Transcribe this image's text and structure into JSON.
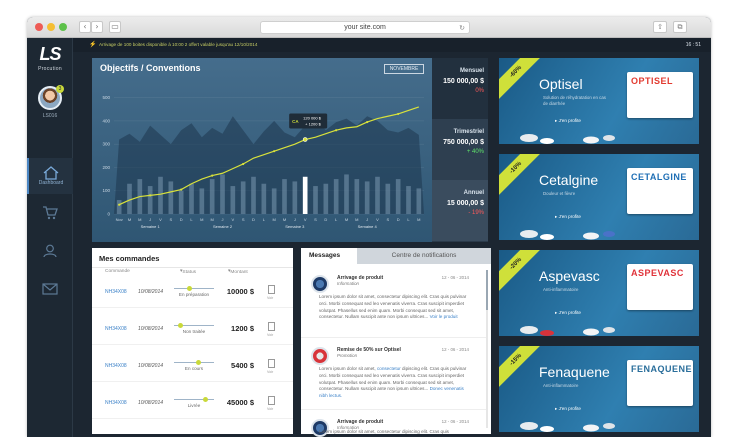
{
  "browser": {
    "url": "your site.com",
    "colors": {
      "red": "#ee5b55",
      "yellow": "#f5be33",
      "green": "#5dc14a"
    }
  },
  "app": {
    "logo_mark": "LS",
    "logo_name": "Procution",
    "user_name": "LS016",
    "user_badge": "3",
    "nav": [
      {
        "label": "Dashboard",
        "icon": "home-icon",
        "active": true
      },
      {
        "label": "",
        "icon": "cart-icon",
        "active": false
      },
      {
        "label": "",
        "icon": "user-icon",
        "active": false
      },
      {
        "label": "",
        "icon": "mail-icon",
        "active": false
      }
    ],
    "ticker": "Arrivage de 100 boites disponible à 10:00 2 offert valable jusqu'au 12/10/2014",
    "clock": "16 : 51"
  },
  "chart_data": {
    "type": "line",
    "title": "Objectifs / Conventions",
    "period": "NOVEMBRE",
    "y_ticks": [
      0,
      100,
      200,
      300,
      400,
      500
    ],
    "ylim": [
      0,
      550
    ],
    "x_labels": [
      "Nov",
      "M",
      "M",
      "J",
      "V",
      "S",
      "D",
      "L",
      "M",
      "M",
      "J",
      "V",
      "S",
      "D",
      "L",
      "M",
      "M",
      "J",
      "V",
      "S",
      "D",
      "L",
      "M",
      "M",
      "J",
      "V",
      "S",
      "D",
      "L",
      "M"
    ],
    "week_labels": [
      "Semaine 1",
      "Semaine 2",
      "Semaine 3",
      "Semaine 4"
    ],
    "series": [
      {
        "values": [
          40,
          60,
          75,
          80,
          85,
          95,
          105,
          130,
          150,
          165,
          175,
          195,
          215,
          240,
          255,
          270,
          285,
          300,
          320,
          330,
          345,
          360,
          370,
          375,
          395,
          410,
          420,
          430,
          445,
          460
        ]
      }
    ],
    "area_values": [
      320,
      345,
      310,
      380,
      340,
      300,
      360,
      390,
      330,
      370,
      345,
      420,
      360,
      300,
      355,
      400,
      350,
      330,
      380,
      410,
      360,
      395,
      410,
      380,
      420,
      400,
      360,
      350,
      370,
      340
    ],
    "bar_values": [
      60,
      130,
      150,
      120,
      160,
      140,
      100,
      130,
      110,
      150,
      170,
      120,
      140,
      160,
      130,
      110,
      150,
      140,
      160,
      120,
      130,
      150,
      170,
      150,
      140,
      160,
      130,
      150,
      120,
      110
    ],
    "highlight_index": 18,
    "tooltip": {
      "label": "CA",
      "line1": "120 000 $",
      "line2": "+ 1200 $"
    }
  },
  "summary": [
    {
      "title": "Mensuel",
      "value": "150 000,00 $",
      "pct": "0%",
      "pct_color": "#ff5a5a"
    },
    {
      "title": "Trimestriel",
      "value": "750 000,00 $",
      "pct": "+ 40%",
      "pct_color": "#5fe36a"
    },
    {
      "title": "Annuel",
      "value": "15 000,00 $",
      "pct": "- 19%",
      "pct_color": "#ff5a5a"
    }
  ],
  "commands": {
    "title": "Mes commandes",
    "headers": {
      "commande": "Commande",
      "status": "Status",
      "montant": "Montant"
    },
    "rows": [
      {
        "num": "NH34X08",
        "date": "10/08/2014",
        "status": "En préparation",
        "progress": 0.35,
        "amount": "10000 $",
        "voir": "Voir"
      },
      {
        "num": "NH34X08",
        "date": "10/08/2014",
        "status": "Non traitée",
        "progress": 0.1,
        "amount": "1200 $",
        "voir": "Voir"
      },
      {
        "num": "NH34X08",
        "date": "10/08/2014",
        "status": "En cours",
        "progress": 0.6,
        "amount": "5400 $",
        "voir": "Voir"
      },
      {
        "num": "NH34X08",
        "date": "10/08/2014",
        "status": "Livrée",
        "progress": 0.8,
        "amount": "45000 $",
        "voir": "Voir"
      }
    ]
  },
  "messages": {
    "tab_messages": "Messages",
    "tab_notifications": "Centre de notifications",
    "items": [
      {
        "title": "Arrivage de produit",
        "category": "Information",
        "date": "12 - 06 - 2014",
        "text_a": "Lorem ipsum dolor sit amet, consectetur dipiscing elit. Cras quis pulvinar orci. Morbi consequat sed leo venenatis viverra. Cras suscipit imperdiet volutpat. Phasellus sed enim quam. Morbi consequat sed sit amet, consectetur. Nullam suscipit ante non ipsum ultrices...",
        "link": "Voir le produit"
      },
      {
        "title": "Remise de 50% sur Optisel",
        "category": "Promotion",
        "date": "12 - 06 - 2014",
        "text_a": "Lorem ipsum dolor sit amet, ",
        "highlight": "consectetur",
        "text_b": " dipiscing elit. Cras quis pulvinar orci. Morbi consequat sed leo venenatis viverra. Cras suscipit imperdiet volutpat. Phasellus sed enim quam. Morbi consequat sed sit amet, consectetur. Nullam suscipit ante non ipsum ultrices...",
        "link": "Donec venenatis nibh lectus."
      },
      {
        "title": "Arrivage de produit",
        "category": "Information",
        "date": "12 - 06 - 2014",
        "text_a": "Lorem ipsum dolor sit amet, consectetur dipiscing elit. Cras quis",
        "link": ""
      }
    ]
  },
  "products": [
    {
      "discount": "-60%",
      "name": "Optisel",
      "desc": "Solution de réhydratation en cas de diarrhée",
      "cta": "J'en profite",
      "box_label": "OPTISEL",
      "box_color": "#e23a2f"
    },
    {
      "discount": "-10%",
      "name": "Cetalgine",
      "desc": "Douleur et fièvre",
      "cta": "J'en profite",
      "box_label": "CETALGINE",
      "box_color": "#1f6fb5"
    },
    {
      "discount": "-20%",
      "name": "Aspevasc",
      "desc": "Anti-inflammatoire",
      "cta": "J'en profite",
      "box_label": "ASPEVASC",
      "box_color": "#e0323a"
    },
    {
      "discount": "-15%",
      "name": "Fenaquene",
      "desc": "Anti-inflammatoire",
      "cta": "J'en profite",
      "box_label": "FENAQUENE",
      "box_color": "#2a6e9b"
    }
  ]
}
